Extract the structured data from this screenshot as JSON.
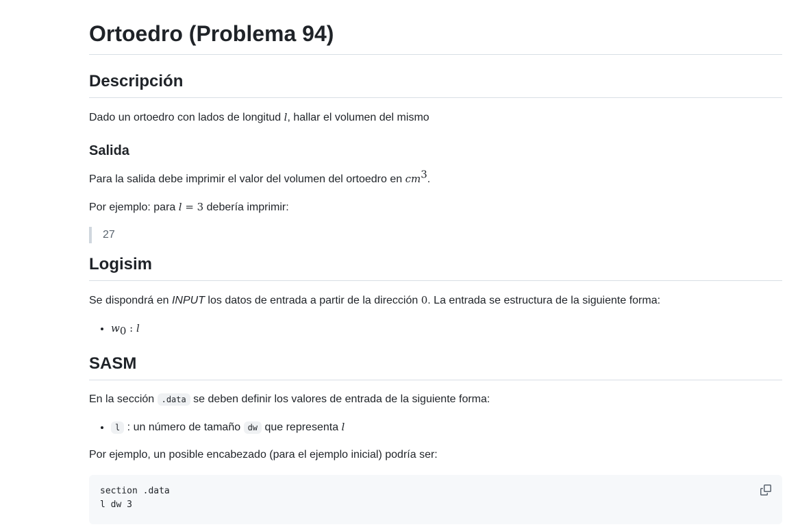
{
  "title": "Ortoedro (Problema 94)",
  "descripcion": {
    "heading": "Descripción",
    "text_before": "Dado un ortoedro con lados de longitud ",
    "math_l": "l",
    "text_after": ", hallar el volumen del mismo"
  },
  "salida": {
    "heading": "Salida",
    "p1_before": "Para la salida debe imprimir el valor del volumen del ortoedro en ",
    "p1_unit": "cm",
    "p1_exp": "3",
    "p1_after": ".",
    "p2_before": "Por ejemplo: para ",
    "p2_math_l": "l",
    "p2_math_eq": " = 3",
    "p2_after": " debería imprimir:",
    "quote": "27"
  },
  "logisim": {
    "heading": "Logisim",
    "p_before": "Se dispondrá en ",
    "p_input": "INPUT",
    "p_mid": " los datos de entrada a partir de la dirección ",
    "p_addr": "0",
    "p_after": ". La entrada se estructura de la siguiente forma:",
    "item_w": "w",
    "item_sub": "0",
    "item_sep": " : ",
    "item_l": "l"
  },
  "sasm": {
    "heading": "SASM",
    "p1_before": "En la sección ",
    "p1_code": ".data",
    "p1_after": " se deben definir los valores de entrada de la siguiente forma:",
    "item_code_l": "l",
    "item_text1": " : un número de tamaño ",
    "item_code_dw": "dw",
    "item_text2": " que representa ",
    "item_math_l": "l",
    "p2": "Por ejemplo, un posible encabezado (para el ejemplo inicial) podría ser:",
    "code_line1": "section .data",
    "code_line2": "l dw 3"
  },
  "icons": {
    "copy": "copy-icon"
  }
}
